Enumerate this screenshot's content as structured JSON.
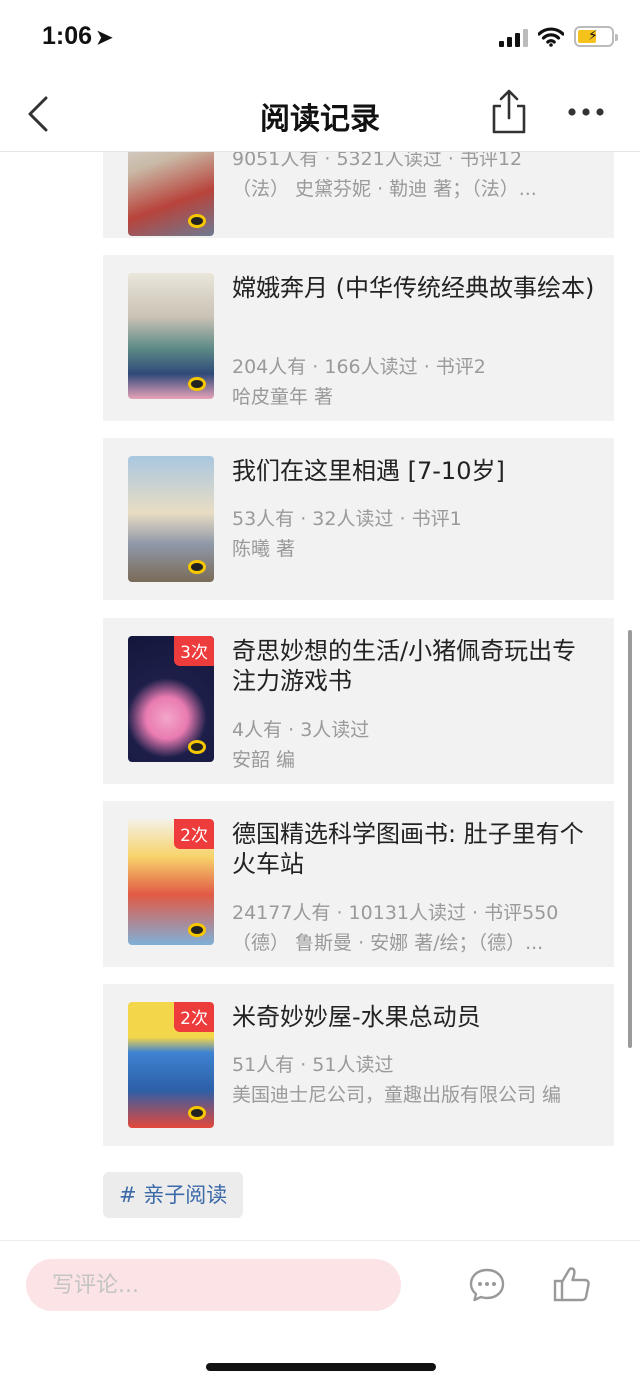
{
  "status_bar": {
    "time": "1:06"
  },
  "nav": {
    "title": "阅读记录"
  },
  "books": [
    {
      "title": "",
      "stats": "9051人有 · 5321人读过 · 书评12",
      "author": "（法） 史黛芬妮 · 勒迪 著；（法）...",
      "badge": "",
      "cover_color": "#e9e3d4"
    },
    {
      "title": "嫦娥奔月 (中华传统经典故事绘本)",
      "stats": "204人有 · 166人读过 · 书评2",
      "author": "哈皮童年 著",
      "badge": "",
      "cover_color": "#3a5a8a"
    },
    {
      "title": "我们在这里相遇 [7-10岁]",
      "stats": "53人有 · 32人读过 · 书评1",
      "author": "陈曦 著",
      "badge": "",
      "cover_color": "#8fb0c8"
    },
    {
      "title": "奇思妙想的生活/小猪佩奇玩出专注力游戏书",
      "stats": "4人有 · 3人读过",
      "author": "安韶 编",
      "badge": "3次",
      "cover_color": "#1d1f4a"
    },
    {
      "title": "德国精选科学图画书: 肚子里有个火车站",
      "stats": "24177人有 · 10131人读过 · 书评550",
      "author": "（德） 鲁斯曼 · 安娜 著/绘；（德）...",
      "badge": "2次",
      "cover_color": "#e25a46"
    },
    {
      "title": "米奇妙妙屋-水果总动员",
      "stats": "51人有 · 51人读过",
      "author": "美国迪士尼公司，童趣出版有限公司 编",
      "badge": "2次",
      "cover_color": "#3f83d1"
    }
  ],
  "tag": {
    "label": "# 亲子阅读"
  },
  "comment": {
    "placeholder": "写评论..."
  },
  "colors": {
    "badge": "#ee3b3b",
    "tag_text": "#3b6aa8",
    "comment_bg": "#fbe3e6"
  }
}
